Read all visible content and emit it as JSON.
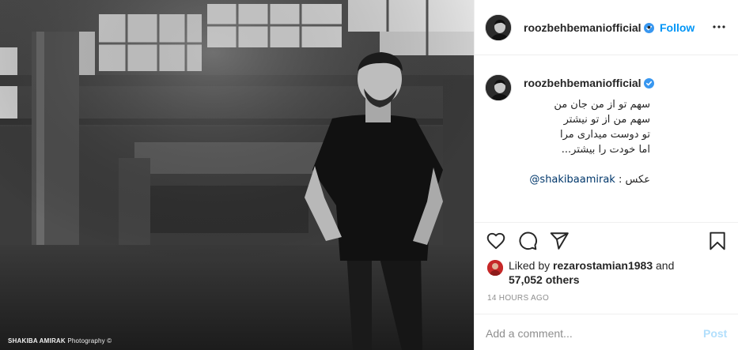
{
  "photo": {
    "credit_name": "SHAKIBA AMIRAK",
    "credit_suffix": "Photography ©"
  },
  "header": {
    "username": "roozbehbemaniofficial",
    "separator": "•",
    "follow_label": "Follow",
    "more_icon": "more-horizontal-icon"
  },
  "caption": {
    "username": "roozbehbemaniofficial",
    "lines": [
      "سهم تو از من جان من",
      "سهم من از تو نیشتر",
      "تو دوست میداری مرا",
      "اما خودت را بیشتر..."
    ],
    "credit_prefix": "عکس : ",
    "mention": "@shakibaamirak"
  },
  "actions": {
    "like_icon": "heart-icon",
    "comment_icon": "comment-icon",
    "share_icon": "share-icon",
    "save_icon": "bookmark-icon"
  },
  "likes": {
    "prefix": "Liked by ",
    "user": "rezarostamian1983",
    "and": " and",
    "others": "57,052 others"
  },
  "timestamp": "14 HOURS AGO",
  "comment": {
    "placeholder": "Add a comment...",
    "post_label": "Post"
  },
  "colors": {
    "accent": "#0095f6",
    "verified": "#3897f0",
    "post_disabled": "#b2dffc",
    "muted": "#8e8e8e"
  }
}
